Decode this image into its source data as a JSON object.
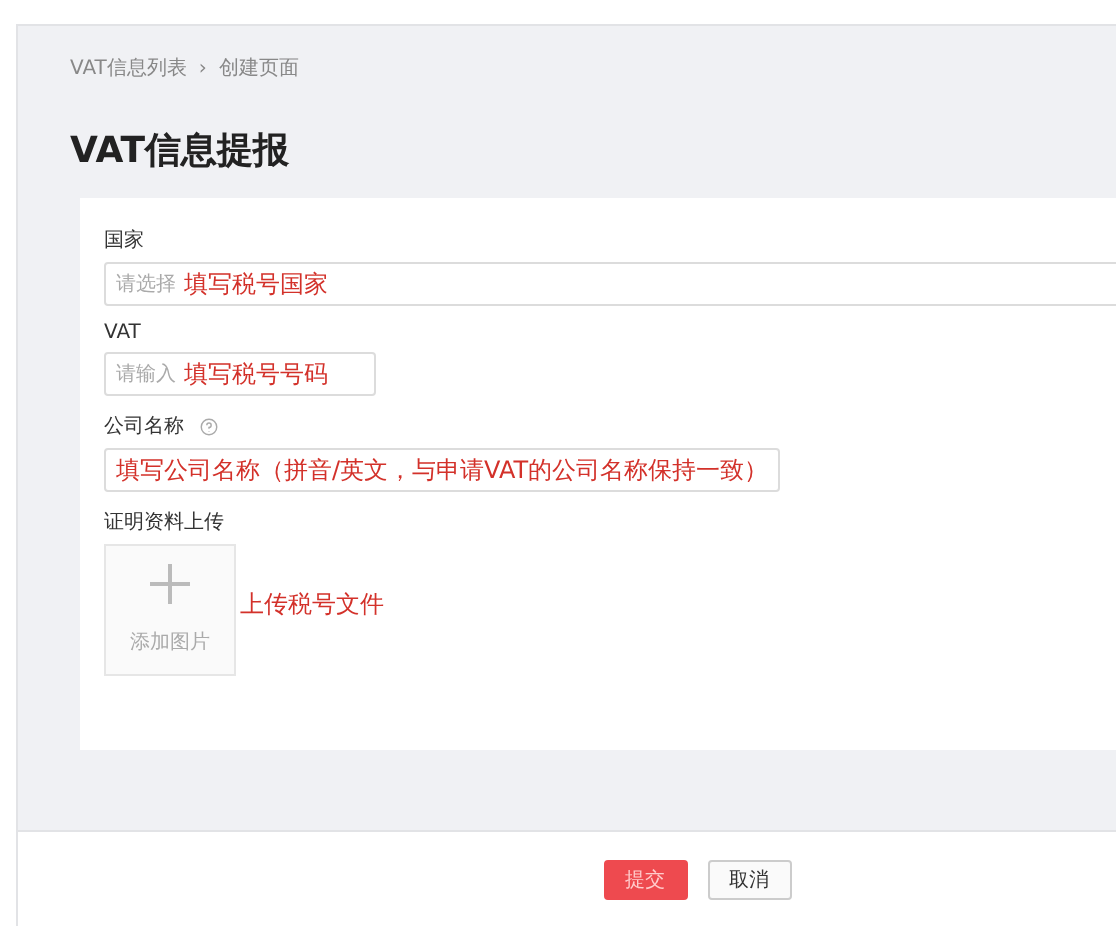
{
  "breadcrumb": [
    {
      "label": "VAT信息列表"
    },
    {
      "label": "创建页面"
    }
  ],
  "breadcrumb_separator": "›",
  "title": "VAT信息提报",
  "form": {
    "fields": [
      {
        "kind": "select",
        "label": "国家",
        "placeholder": "请选择",
        "annotation": "填写税号国家"
      },
      {
        "kind": "input",
        "label": "VAT",
        "placeholder": "请输入",
        "annotation": "填写税号号码"
      },
      {
        "kind": "input",
        "label": "公司名称",
        "help": true,
        "annotation": "填写公司名称（拼音/英文，与申请VAT的公司名称保持一致）"
      },
      {
        "kind": "upload",
        "label": "证明资料上传",
        "button_label": "添加图片",
        "annotation": "上传税号文件"
      }
    ]
  },
  "footer": {
    "buttons": [
      {
        "label": "提交",
        "primary": true
      },
      {
        "label": "取消",
        "primary": false
      }
    ]
  }
}
